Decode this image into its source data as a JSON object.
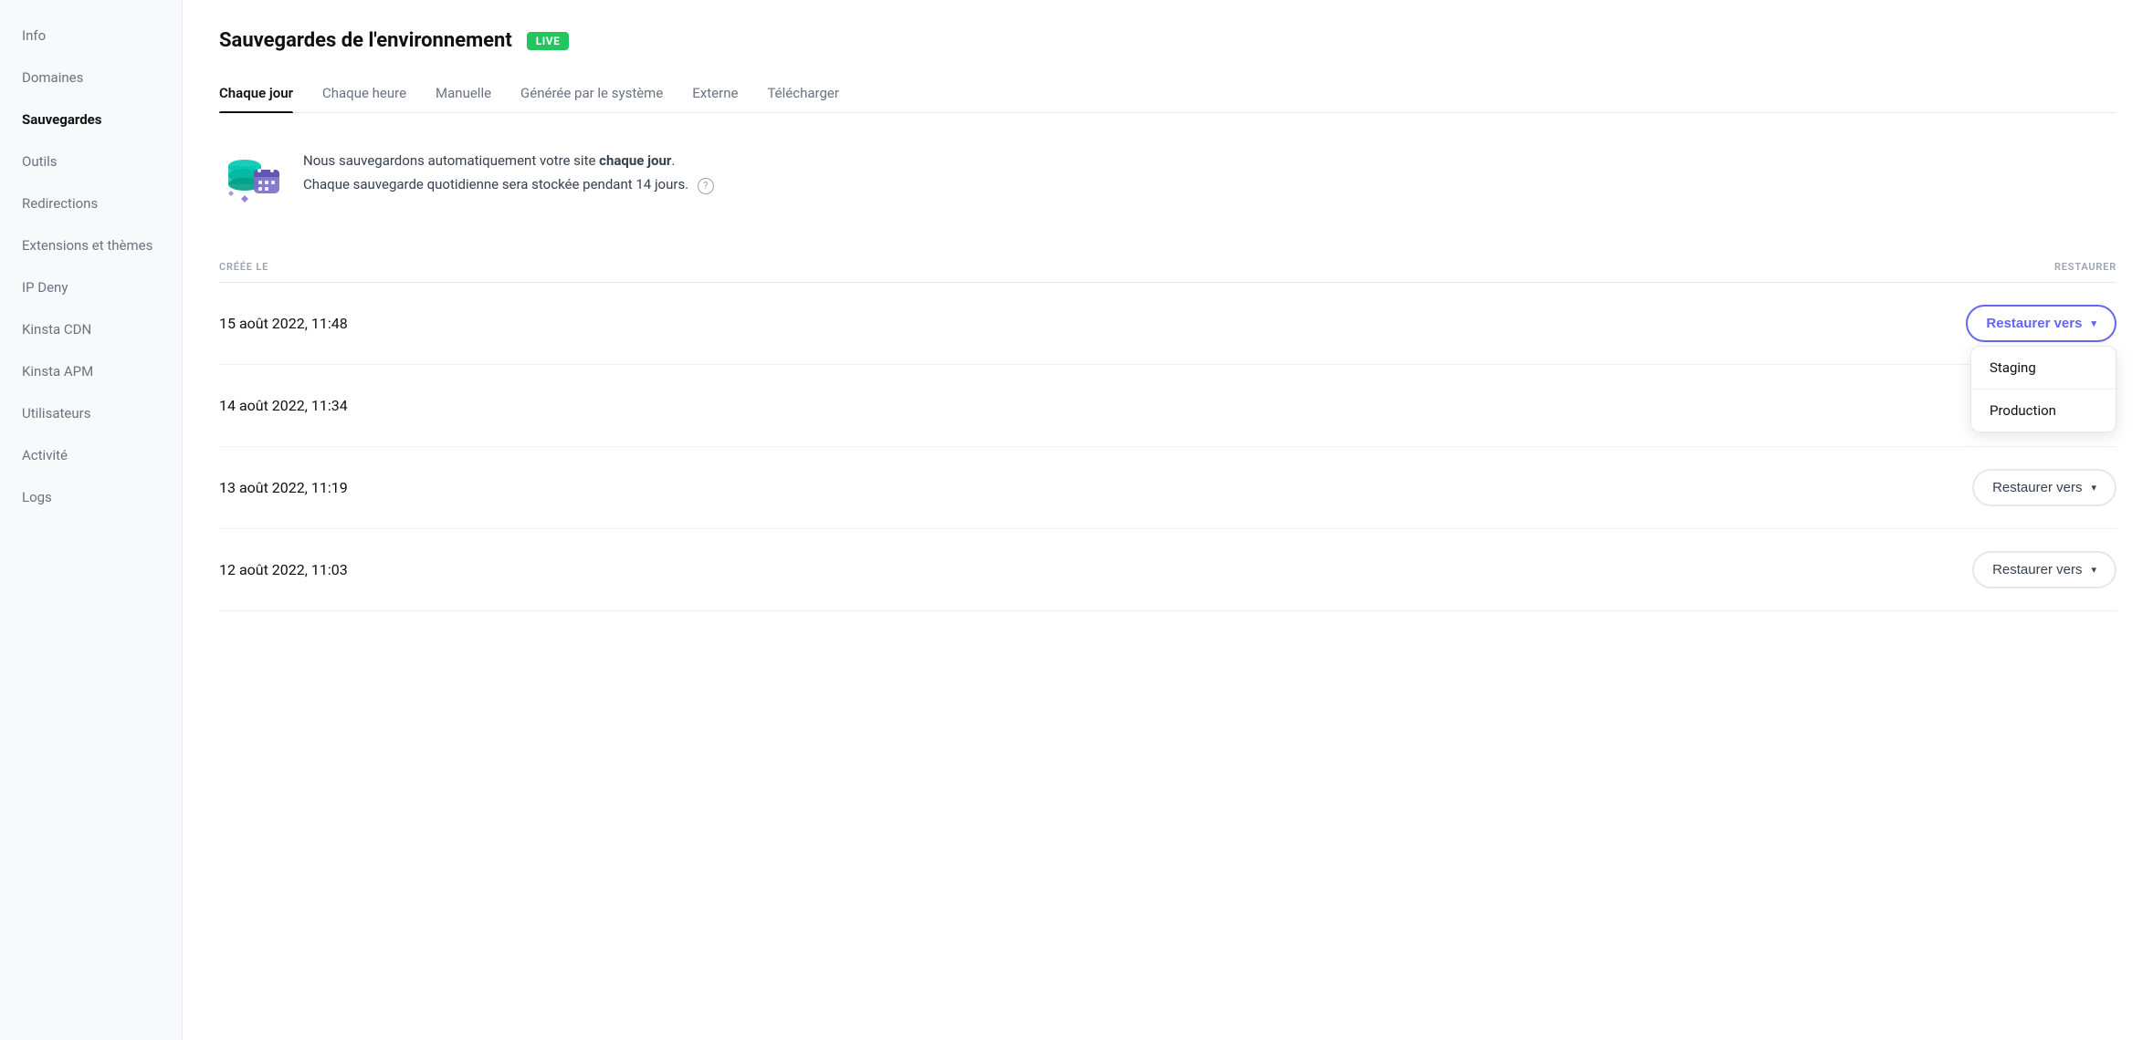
{
  "sidebar": {
    "items": [
      {
        "id": "info",
        "label": "Info",
        "active": false
      },
      {
        "id": "domaines",
        "label": "Domaines",
        "active": false
      },
      {
        "id": "sauvegardes",
        "label": "Sauvegardes",
        "active": true
      },
      {
        "id": "outils",
        "label": "Outils",
        "active": false
      },
      {
        "id": "redirections",
        "label": "Redirections",
        "active": false
      },
      {
        "id": "extensions",
        "label": "Extensions et thèmes",
        "active": false
      },
      {
        "id": "ip-deny",
        "label": "IP Deny",
        "active": false
      },
      {
        "id": "kinsta-cdn",
        "label": "Kinsta CDN",
        "active": false
      },
      {
        "id": "kinsta-apm",
        "label": "Kinsta APM",
        "active": false
      },
      {
        "id": "utilisateurs",
        "label": "Utilisateurs",
        "active": false
      },
      {
        "id": "activite",
        "label": "Activité",
        "active": false
      },
      {
        "id": "logs",
        "label": "Logs",
        "active": false
      }
    ]
  },
  "header": {
    "title": "Sauvegardes de l'environnement",
    "badge": "LIVE"
  },
  "tabs": [
    {
      "id": "chaque-jour",
      "label": "Chaque jour",
      "active": true
    },
    {
      "id": "chaque-heure",
      "label": "Chaque heure",
      "active": false
    },
    {
      "id": "manuelle",
      "label": "Manuelle",
      "active": false
    },
    {
      "id": "generee",
      "label": "Générée par le système",
      "active": false
    },
    {
      "id": "externe",
      "label": "Externe",
      "active": false
    },
    {
      "id": "telecharger",
      "label": "Télécharger",
      "active": false
    }
  ],
  "info": {
    "text_before": "Nous sauvegardons automatiquement votre site ",
    "text_bold": "chaque jour",
    "text_after": ".",
    "text2": "Chaque sauvegarde quotidienne sera stockée pendant 14 jours."
  },
  "table": {
    "col_created": "CRÉÉE LE",
    "col_restore": "RESTAURER",
    "rows": [
      {
        "id": "row1",
        "date": "15 août 2022, 11:48",
        "active": true
      },
      {
        "id": "row2",
        "date": "14 août 2022, 11:34",
        "active": false
      },
      {
        "id": "row3",
        "date": "13 août 2022, 11:19",
        "active": false
      },
      {
        "id": "row4",
        "date": "12 août 2022, 11:03",
        "active": false
      }
    ],
    "restore_label": "Restaurer vers",
    "dropdown_staging": "Staging",
    "dropdown_production": "Production"
  },
  "colors": {
    "accent": "#6366f1",
    "live_green": "#22c55e",
    "active_border": "#6366f1"
  }
}
